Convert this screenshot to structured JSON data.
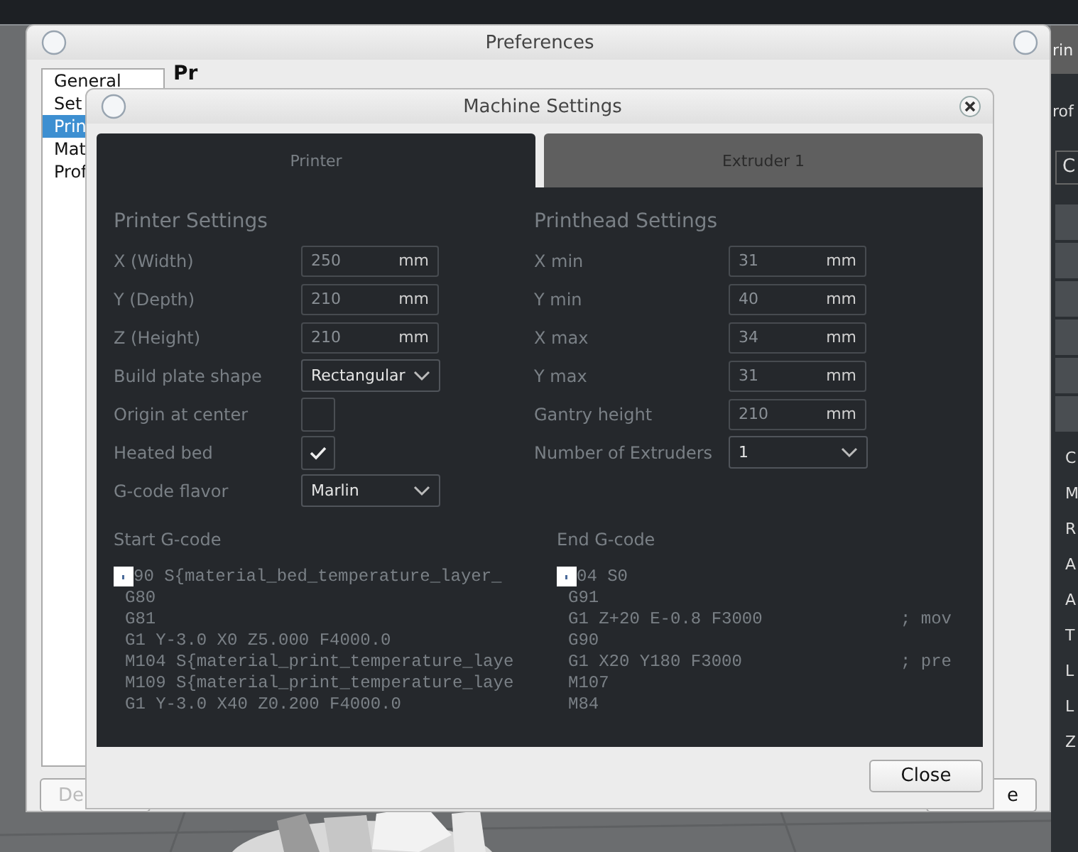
{
  "right_panel": {
    "header": "rin",
    "profile": "rof",
    "field": "C",
    "items": [
      "C",
      "M",
      "R",
      "A",
      "A",
      "T",
      "L",
      "L",
      "Z"
    ]
  },
  "preferences": {
    "title": "Preferences",
    "heading": "Pr",
    "sidebar": [
      {
        "label": "General",
        "selected": false
      },
      {
        "label": "Set",
        "selected": false
      },
      {
        "label": "Prin",
        "selected": true
      },
      {
        "label": "Mat",
        "selected": false
      },
      {
        "label": "Prof",
        "selected": false
      }
    ],
    "buttons": [
      {
        "label": "De",
        "disabled": true
      },
      {
        "label": "e",
        "disabled": false
      }
    ]
  },
  "machine_settings": {
    "title": "Machine Settings",
    "tabs": [
      {
        "label": "Printer",
        "selected": true
      },
      {
        "label": "Extruder 1",
        "selected": false
      }
    ],
    "printer": {
      "heading": "Printer Settings",
      "rows": [
        {
          "label": "X (Width)",
          "kind": "number",
          "value": "250",
          "unit": "mm"
        },
        {
          "label": "Y (Depth)",
          "kind": "number",
          "value": "210",
          "unit": "mm"
        },
        {
          "label": "Z (Height)",
          "kind": "number",
          "value": "210",
          "unit": "mm"
        },
        {
          "label": "Build plate shape",
          "kind": "dropdown",
          "value": "Rectangular"
        },
        {
          "label": "Origin at center",
          "kind": "checkbox",
          "checked": false
        },
        {
          "label": "Heated bed",
          "kind": "checkbox",
          "checked": true
        },
        {
          "label": "G-code flavor",
          "kind": "dropdown",
          "value": "Marlin"
        }
      ]
    },
    "printhead": {
      "heading": "Printhead Settings",
      "rows": [
        {
          "label": "X min",
          "kind": "number",
          "value": "31",
          "unit": "mm"
        },
        {
          "label": "Y min",
          "kind": "number",
          "value": "40",
          "unit": "mm"
        },
        {
          "label": "X max",
          "kind": "number",
          "value": "34",
          "unit": "mm"
        },
        {
          "label": "Y max",
          "kind": "number",
          "value": "31",
          "unit": "mm"
        },
        {
          "label": "Gantry height",
          "kind": "number",
          "value": "210",
          "unit": "mm"
        },
        {
          "label": "Number of Extruders",
          "kind": "dropdown",
          "value": "1"
        }
      ]
    },
    "start_gcode": {
      "heading": "Start G-code",
      "lines": [
        {
          "code": "90 S{material_bed_temperature_layer_"
        },
        {
          "code": "G80"
        },
        {
          "code": "G81"
        },
        {
          "code": "G1 Y-3.0 X0 Z5.000 F4000.0"
        },
        {
          "code": "M104 S{material_print_temperature_laye"
        },
        {
          "code": "M109 S{material_print_temperature_laye"
        },
        {
          "code": "G1 Y-3.0 X40 Z0.200 F4000.0"
        }
      ]
    },
    "end_gcode": {
      "heading": "End G-code",
      "lines": [
        {
          "code": "04 S0"
        },
        {
          "code": "G91"
        },
        {
          "code": "G1 Z+20 E-0.8 F3000",
          "comment": "; mov"
        },
        {
          "code": "G90"
        },
        {
          "code": "G1 X20 Y180 F3000",
          "comment": "; pre"
        },
        {
          "code": "M107"
        },
        {
          "code": "M84"
        }
      ]
    },
    "close_button": "Close"
  }
}
